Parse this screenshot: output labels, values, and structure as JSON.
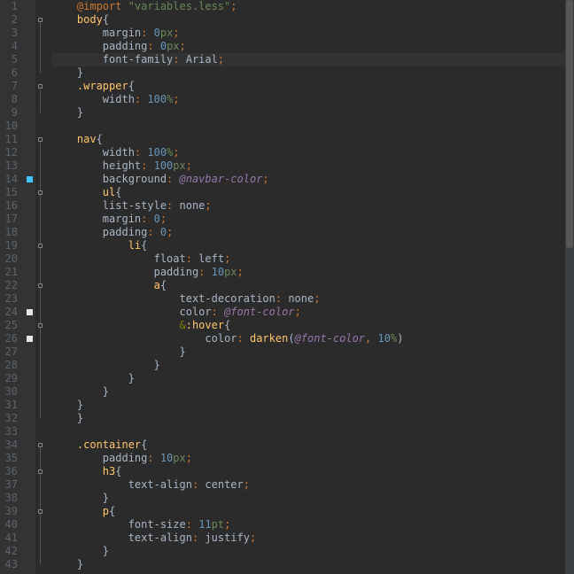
{
  "editor": {
    "line_height": 15,
    "total_lines": 43,
    "highlighted_line": 5,
    "markers": [
      {
        "line": 14,
        "color": "blue"
      },
      {
        "line": 24,
        "color": "white"
      },
      {
        "line": 26,
        "color": "white"
      }
    ],
    "fold_regions": [
      {
        "start": 2,
        "end": 6
      },
      {
        "start": 7,
        "end": 9
      },
      {
        "start": 11,
        "end": 32
      },
      {
        "start": 15,
        "end": 31
      },
      {
        "start": 19,
        "end": 30
      },
      {
        "start": 22,
        "end": 29
      },
      {
        "start": 25,
        "end": 28
      },
      {
        "start": 34,
        "end": 43
      },
      {
        "start": 36,
        "end": 38
      },
      {
        "start": 39,
        "end": 42
      }
    ],
    "lines": [
      {
        "n": 1,
        "tokens": [
          [
            "keyword",
            "@import "
          ],
          [
            "string",
            "\"variables.less\""
          ],
          [
            "punct",
            ";"
          ]
        ]
      },
      {
        "n": 2,
        "tokens": [
          [
            "selector",
            "body"
          ],
          [
            "brace",
            "{"
          ]
        ]
      },
      {
        "n": 3,
        "indent": 2,
        "tokens": [
          [
            "prop",
            "margin"
          ],
          [
            "punct",
            ": "
          ],
          [
            "num",
            "0"
          ],
          [
            "unit",
            "px"
          ],
          [
            "punct",
            ";"
          ]
        ]
      },
      {
        "n": 4,
        "indent": 2,
        "tokens": [
          [
            "prop",
            "padding"
          ],
          [
            "punct",
            ": "
          ],
          [
            "num",
            "0"
          ],
          [
            "unit",
            "px"
          ],
          [
            "punct",
            ";"
          ]
        ]
      },
      {
        "n": 5,
        "indent": 2,
        "hl": true,
        "tokens": [
          [
            "prop",
            "font-family"
          ],
          [
            "punct",
            ": "
          ],
          [
            "value",
            "Arial"
          ],
          [
            "punct",
            ";"
          ]
        ]
      },
      {
        "n": 6,
        "tokens": [
          [
            "brace",
            "}"
          ]
        ]
      },
      {
        "n": 7,
        "tokens": [
          [
            "selector",
            ".wrapper"
          ],
          [
            "brace",
            "{"
          ]
        ]
      },
      {
        "n": 8,
        "indent": 2,
        "tokens": [
          [
            "prop",
            "width"
          ],
          [
            "punct",
            ": "
          ],
          [
            "num",
            "100"
          ],
          [
            "unit",
            "%"
          ],
          [
            "punct",
            ";"
          ]
        ]
      },
      {
        "n": 9,
        "tokens": [
          [
            "brace",
            "}"
          ]
        ]
      },
      {
        "n": 10,
        "tokens": []
      },
      {
        "n": 11,
        "tokens": [
          [
            "selector",
            "nav"
          ],
          [
            "brace",
            "{"
          ]
        ]
      },
      {
        "n": 12,
        "indent": 2,
        "tokens": [
          [
            "prop",
            "width"
          ],
          [
            "punct",
            ": "
          ],
          [
            "num",
            "100"
          ],
          [
            "unit",
            "%"
          ],
          [
            "punct",
            ";"
          ]
        ]
      },
      {
        "n": 13,
        "indent": 2,
        "tokens": [
          [
            "prop",
            "height"
          ],
          [
            "punct",
            ": "
          ],
          [
            "num",
            "100"
          ],
          [
            "unit",
            "px"
          ],
          [
            "punct",
            ";"
          ]
        ]
      },
      {
        "n": 14,
        "indent": 2,
        "tokens": [
          [
            "prop",
            "background"
          ],
          [
            "punct",
            ": "
          ],
          [
            "var",
            "@navbar-color"
          ],
          [
            "punct",
            ";"
          ]
        ]
      },
      {
        "n": 15,
        "indent": 2,
        "tokens": [
          [
            "selector",
            "ul"
          ],
          [
            "brace",
            "{"
          ]
        ]
      },
      {
        "n": 16,
        "indent": 2,
        "tokens": [
          [
            "prop",
            "list-style"
          ],
          [
            "punct",
            ": "
          ],
          [
            "value",
            "none"
          ],
          [
            "punct",
            ";"
          ]
        ]
      },
      {
        "n": 17,
        "indent": 2,
        "tokens": [
          [
            "prop",
            "margin"
          ],
          [
            "punct",
            ": "
          ],
          [
            "num",
            "0"
          ],
          [
            "punct",
            ";"
          ]
        ]
      },
      {
        "n": 18,
        "indent": 2,
        "tokens": [
          [
            "prop",
            "padding"
          ],
          [
            "punct",
            ": "
          ],
          [
            "num",
            "0"
          ],
          [
            "punct",
            ";"
          ]
        ]
      },
      {
        "n": 19,
        "indent": 4,
        "tokens": [
          [
            "selector",
            "li"
          ],
          [
            "brace",
            "{"
          ]
        ]
      },
      {
        "n": 20,
        "indent": 6,
        "tokens": [
          [
            "prop",
            "float"
          ],
          [
            "punct",
            ": "
          ],
          [
            "value",
            "left"
          ],
          [
            "punct",
            ";"
          ]
        ]
      },
      {
        "n": 21,
        "indent": 6,
        "tokens": [
          [
            "prop",
            "padding"
          ],
          [
            "punct",
            ": "
          ],
          [
            "num",
            "10"
          ],
          [
            "unit",
            "px"
          ],
          [
            "punct",
            ";"
          ]
        ]
      },
      {
        "n": 22,
        "indent": 6,
        "tokens": [
          [
            "selector",
            "a"
          ],
          [
            "brace",
            "{"
          ]
        ]
      },
      {
        "n": 23,
        "indent": 8,
        "tokens": [
          [
            "prop",
            "text-decoration"
          ],
          [
            "punct",
            ": "
          ],
          [
            "value",
            "none"
          ],
          [
            "punct",
            ";"
          ]
        ]
      },
      {
        "n": 24,
        "indent": 8,
        "tokens": [
          [
            "prop",
            "color"
          ],
          [
            "punct",
            ": "
          ],
          [
            "var",
            "@font-color"
          ],
          [
            "punct",
            ";"
          ]
        ]
      },
      {
        "n": 25,
        "indent": 8,
        "tokens": [
          [
            "olive",
            "&"
          ],
          [
            "pseudo",
            ":hover"
          ],
          [
            "brace",
            "{"
          ]
        ]
      },
      {
        "n": 26,
        "indent": 10,
        "tokens": [
          [
            "prop",
            "color"
          ],
          [
            "punct",
            ": "
          ],
          [
            "func",
            "darken"
          ],
          [
            "brace",
            "("
          ],
          [
            "var",
            "@font-color"
          ],
          [
            "punct",
            ", "
          ],
          [
            "num",
            "10"
          ],
          [
            "unit",
            "%"
          ],
          [
            "brace",
            ")"
          ]
        ]
      },
      {
        "n": 27,
        "indent": 8,
        "tokens": [
          [
            "brace",
            "}"
          ]
        ]
      },
      {
        "n": 28,
        "indent": 6,
        "tokens": [
          [
            "brace",
            "}"
          ]
        ]
      },
      {
        "n": 29,
        "indent": 4,
        "tokens": [
          [
            "brace",
            "}"
          ]
        ]
      },
      {
        "n": 30,
        "indent": 2,
        "tokens": [
          [
            "brace",
            "}"
          ]
        ]
      },
      {
        "n": 31,
        "tokens": [
          [
            "brace",
            "}"
          ]
        ]
      },
      {
        "n": 32,
        "tokens": [
          [
            "brace",
            "}"
          ]
        ]
      },
      {
        "n": 33,
        "tokens": []
      },
      {
        "n": 34,
        "tokens": [
          [
            "selector",
            ".container"
          ],
          [
            "brace",
            "{"
          ]
        ]
      },
      {
        "n": 35,
        "indent": 2,
        "tokens": [
          [
            "prop",
            "padding"
          ],
          [
            "punct",
            ": "
          ],
          [
            "num",
            "10"
          ],
          [
            "unit",
            "px"
          ],
          [
            "punct",
            ";"
          ]
        ]
      },
      {
        "n": 36,
        "indent": 2,
        "tokens": [
          [
            "selector",
            "h3"
          ],
          [
            "brace",
            "{"
          ]
        ]
      },
      {
        "n": 37,
        "indent": 4,
        "tokens": [
          [
            "prop",
            "text-align"
          ],
          [
            "punct",
            ": "
          ],
          [
            "value",
            "center"
          ],
          [
            "punct",
            ";"
          ]
        ]
      },
      {
        "n": 38,
        "indent": 2,
        "tokens": [
          [
            "brace",
            "}"
          ]
        ]
      },
      {
        "n": 39,
        "indent": 2,
        "tokens": [
          [
            "selector",
            "p"
          ],
          [
            "brace",
            "{"
          ]
        ]
      },
      {
        "n": 40,
        "indent": 4,
        "tokens": [
          [
            "prop",
            "font-size"
          ],
          [
            "punct",
            ": "
          ],
          [
            "num",
            "11"
          ],
          [
            "unit",
            "pt"
          ],
          [
            "punct",
            ";"
          ]
        ]
      },
      {
        "n": 41,
        "indent": 4,
        "tokens": [
          [
            "prop",
            "text-align"
          ],
          [
            "punct",
            ": "
          ],
          [
            "value",
            "justify"
          ],
          [
            "punct",
            ";"
          ]
        ]
      },
      {
        "n": 42,
        "indent": 2,
        "tokens": [
          [
            "brace",
            "}"
          ]
        ]
      },
      {
        "n": 43,
        "tokens": [
          [
            "brace",
            "}"
          ]
        ]
      }
    ]
  }
}
